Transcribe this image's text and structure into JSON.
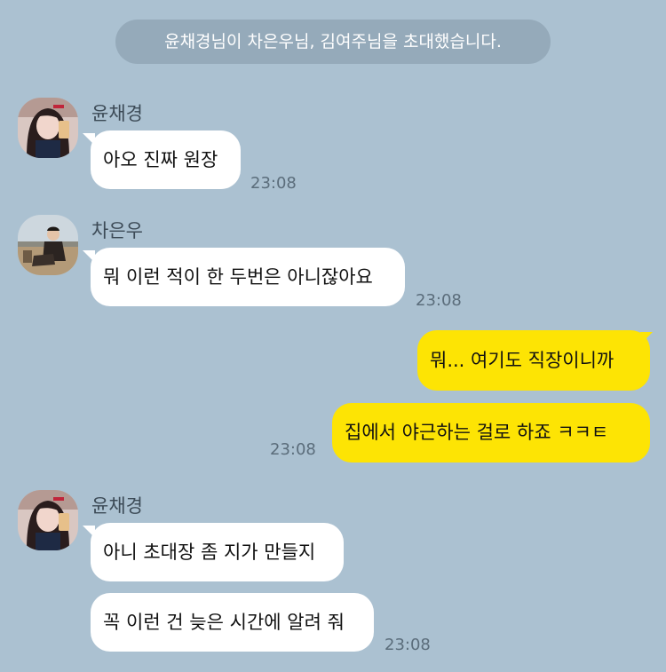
{
  "system_notice": "윤채경님이 차은우님, 김여주님을 초대했습니다.",
  "messages": [
    {
      "sender": "윤채경",
      "avatar": "avatar-photo-woman-mirror-selfie",
      "text": "아오 진짜 원장",
      "time": "23:08"
    },
    {
      "sender": "차은우",
      "avatar": "avatar-photo-man-sitting-outdoors",
      "text": "뭐 이런 적이 한 두번은 아니잖아요",
      "time": "23:08"
    },
    {
      "sender": "me",
      "text": "뭐... 여기도 직장이니까"
    },
    {
      "sender": "me",
      "text": "집에서 야근하는 걸로 하죠 ㅋㅋㅌ",
      "time": "23:08"
    },
    {
      "sender": "윤채경",
      "avatar": "avatar-photo-woman-mirror-selfie",
      "text": "아니 초대장 좀 지가 만들지"
    },
    {
      "sender": "윤채경",
      "text": "꼭 이런 건 늦은 시간에 알려 줘",
      "time": "23:08"
    }
  ],
  "colors": {
    "background": "#abc1d1",
    "incoming_bubble": "#ffffff",
    "outgoing_bubble": "#fde404",
    "system_pill": "#95aaba"
  }
}
